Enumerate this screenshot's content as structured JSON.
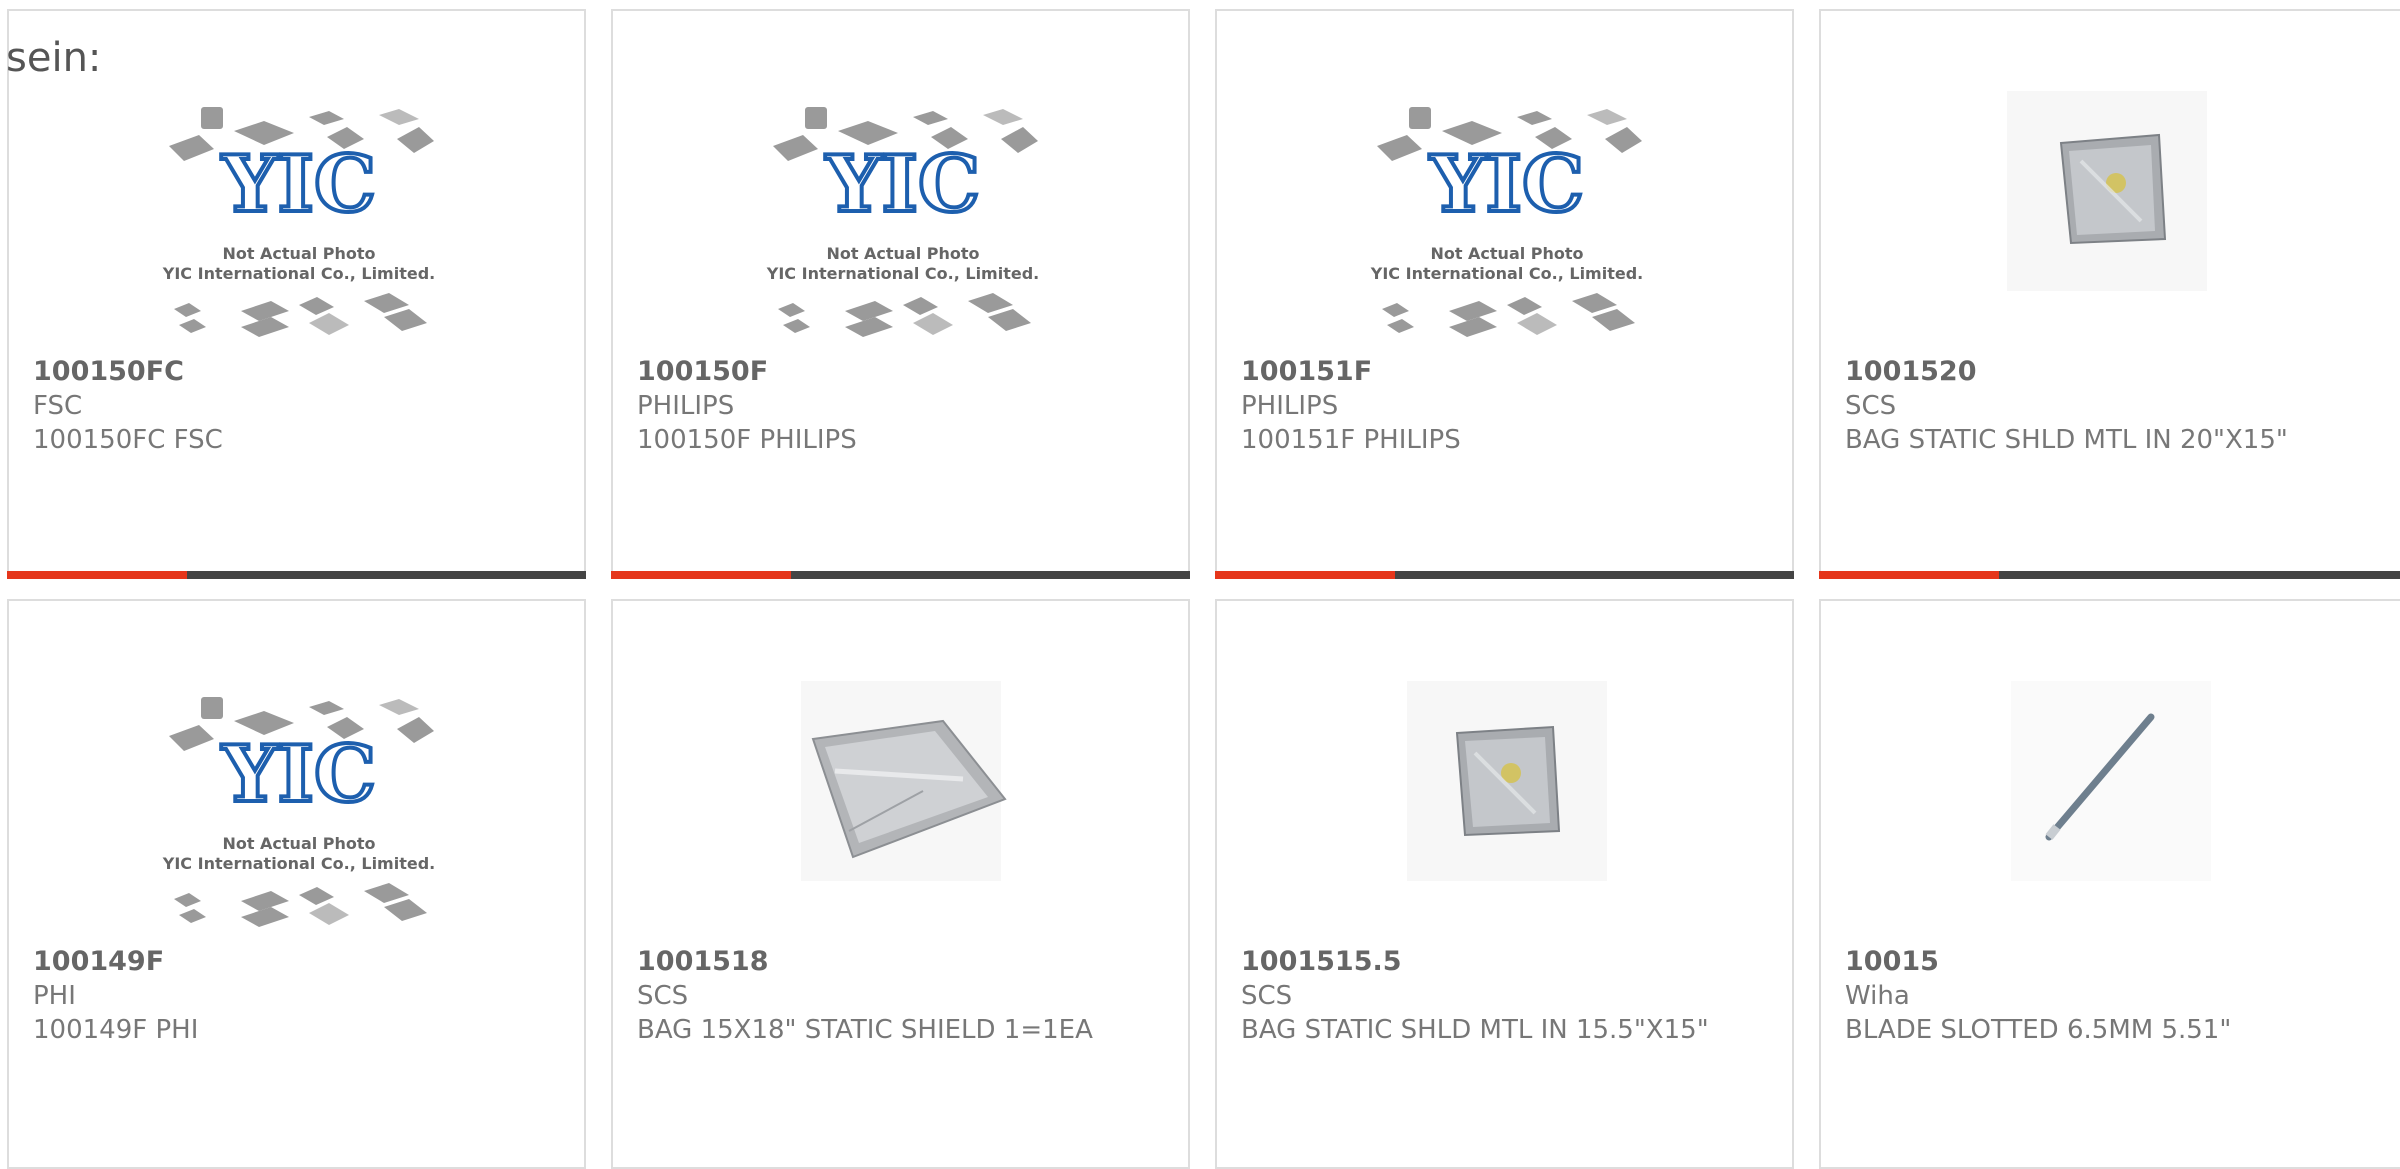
{
  "page": {
    "label_partial": "sein:"
  },
  "colors": {
    "accent": "#e5361b",
    "bar": "#444444",
    "border": "#dddddd",
    "text": "#777777"
  },
  "placeholder": {
    "line1": "Not Actual Photo",
    "line2": "YIC International Co., Limited."
  },
  "products": [
    {
      "part_number": "100150FC",
      "manufacturer": "FSC",
      "description": "100150FC FSC",
      "image": "yic-placeholder-icon",
      "has_bar": true
    },
    {
      "part_number": "100150F",
      "manufacturer": "PHILIPS",
      "description": "100150F PHILIPS",
      "image": "yic-placeholder-icon",
      "has_bar": true
    },
    {
      "part_number": "100151F",
      "manufacturer": "PHILIPS",
      "description": "100151F PHILIPS",
      "image": "yic-placeholder-icon",
      "has_bar": true
    },
    {
      "part_number": "1001520",
      "manufacturer": "SCS",
      "description": "BAG STATIC SHLD MTL IN 20\"X15\"",
      "image": "static-bag-small-icon",
      "has_bar": true
    },
    {
      "part_number": "100149F",
      "manufacturer": "PHI",
      "description": "100149F PHI",
      "image": "yic-placeholder-icon",
      "has_bar": false
    },
    {
      "part_number": "1001518",
      "manufacturer": "SCS",
      "description": "BAG 15X18\" STATIC SHIELD 1=1EA",
      "image": "static-bag-large-icon",
      "has_bar": false
    },
    {
      "part_number": "1001515.5",
      "manufacturer": "SCS",
      "description": "BAG STATIC SHLD MTL IN 15.5\"X15\"",
      "image": "static-bag-small-icon",
      "has_bar": false
    },
    {
      "part_number": "10015",
      "manufacturer": "Wiha",
      "description": "BLADE SLOTTED 6.5MM 5.51\"",
      "image": "slotted-blade-icon",
      "has_bar": false
    }
  ]
}
